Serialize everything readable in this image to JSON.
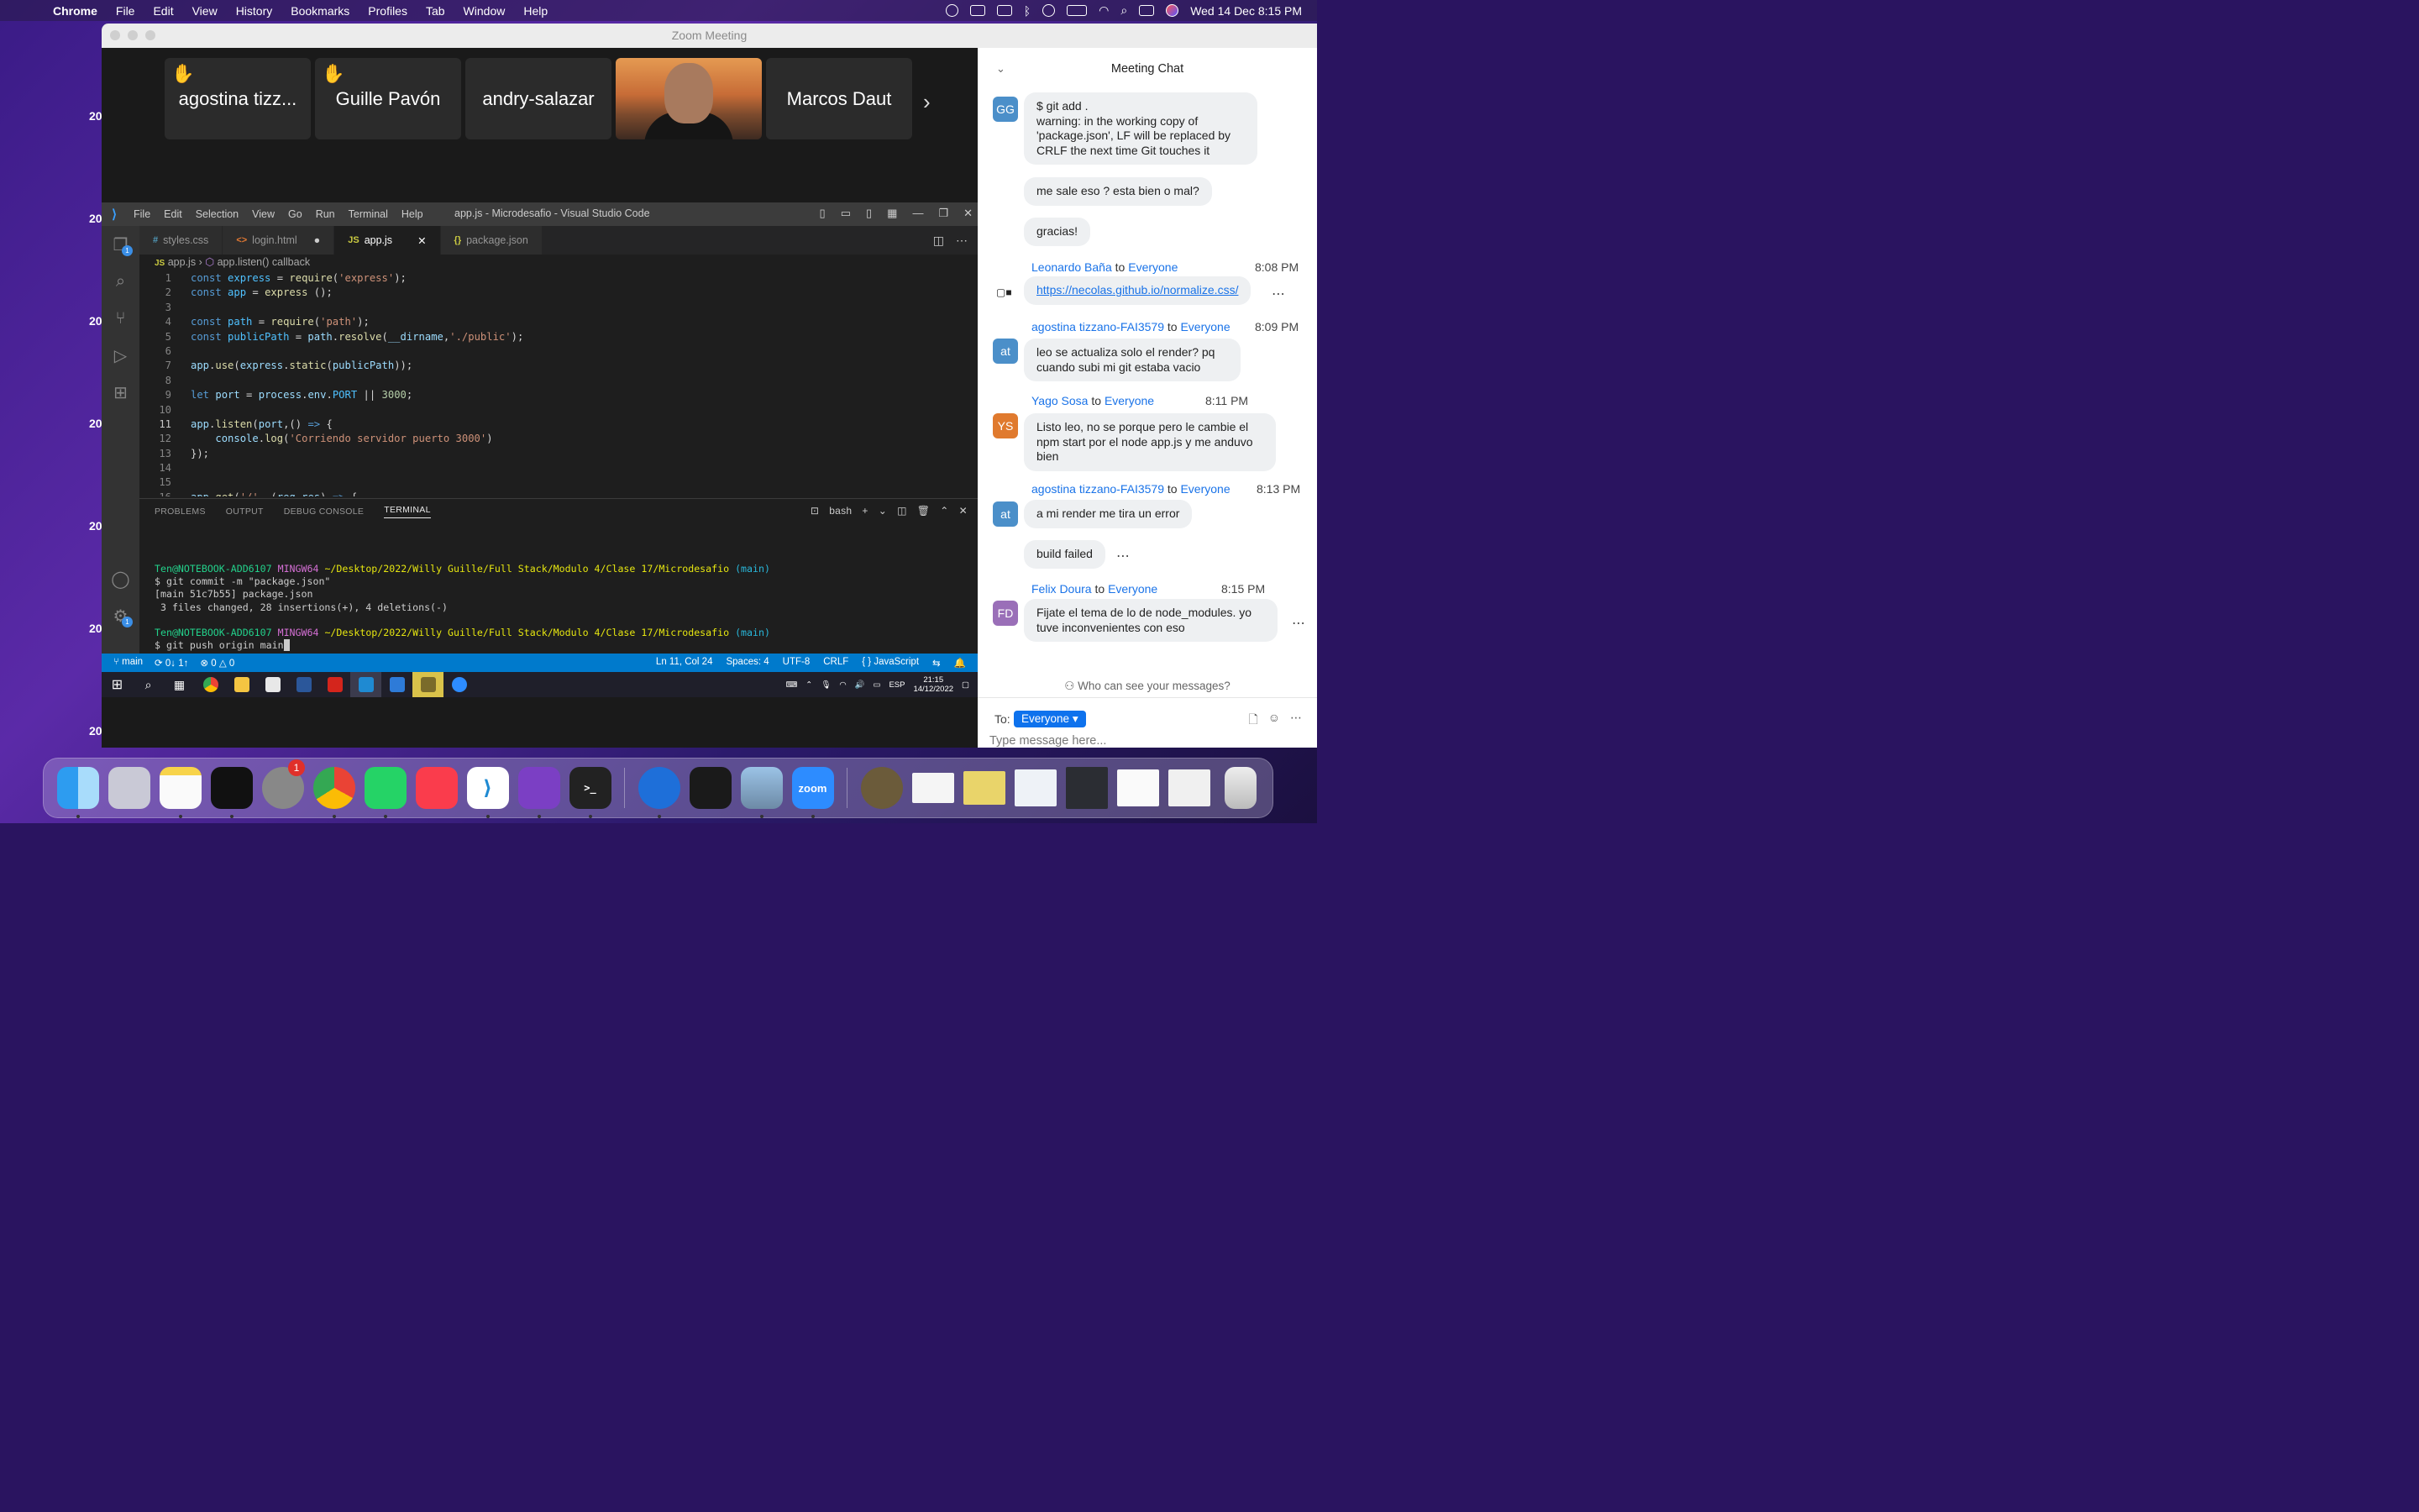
{
  "menubar": {
    "app_name": "Chrome",
    "items": [
      "File",
      "Edit",
      "View",
      "History",
      "Bookmarks",
      "Profiles",
      "Tab",
      "Window",
      "Help"
    ],
    "datetime": "Wed 14 Dec  8:15 PM"
  },
  "zoom": {
    "title": "Zoom Meeting",
    "participants": [
      {
        "name": "agostina tizz...",
        "hand_raised": true
      },
      {
        "name": "Guille Pavón",
        "hand_raised": true
      },
      {
        "name": "andry-salazar",
        "hand_raised": false
      },
      {
        "name": "",
        "hand_raised": false,
        "video": true
      },
      {
        "name": "Marcos Daut",
        "hand_raised": false
      }
    ]
  },
  "vscode": {
    "menu": [
      "File",
      "Edit",
      "Selection",
      "View",
      "Go",
      "Run",
      "Terminal",
      "Help"
    ],
    "title": "app.js - Microdesafio - Visual Studio Code",
    "tabs": [
      {
        "icon": "#",
        "label": "styles.css",
        "active": false
      },
      {
        "icon": "<>",
        "label": "login.html",
        "active": false,
        "modified": true
      },
      {
        "icon": "JS",
        "label": "app.js",
        "active": true
      },
      {
        "icon": "{}",
        "label": "package.json",
        "active": false
      }
    ],
    "breadcrumb": {
      "file": "app.js",
      "symbol": "app.listen() callback"
    },
    "explorer_badge": "1",
    "settings_badge": "1",
    "panel_tabs": [
      "PROBLEMS",
      "OUTPUT",
      "DEBUG CONSOLE",
      "TERMINAL"
    ],
    "panel_shell": "bash",
    "terminal": {
      "user": "Ten@NOTEBOOK-ADD6107",
      "env": "MINGW64",
      "path": "~/Desktop/2022/Willy Guille/Full Stack/Modulo 4/Clase 17/Microdesafio",
      "branch": "(main)",
      "cmd1": "$ git commit -m \"package.json\"",
      "out1": "[main 51c7b55] package.json",
      "out2": " 3 files changed, 28 insertions(+), 4 deletions(-)",
      "cmd2": "$ git push origin main"
    },
    "status": {
      "branch": "main",
      "sync": "0↓ 1↑",
      "problems": "0 △ 0",
      "position": "Ln 11, Col 24",
      "spaces": "Spaces: 4",
      "encoding": "UTF-8",
      "eol": "CRLF",
      "language": "{ } JavaScript"
    }
  },
  "windows_taskbar": {
    "lang": "ESP",
    "time": "21:15",
    "date": "14/12/2022"
  },
  "chat": {
    "title": "Meeting Chat",
    "messages": [
      {
        "avatar": "GG",
        "text": "$ git add .\nwarning: in the working copy of 'package.json', LF will be replaced by CRLF the next time Git touches it"
      },
      {
        "text": "me sale eso ? esta bien o mal?"
      },
      {
        "text": "gracias!"
      },
      {
        "sender": "Leonardo Baña",
        "to": "Everyone",
        "time": "8:08 PM",
        "link": "https://necolas.github.io/normalize.css/"
      },
      {
        "sender": "agostina tizzano-FAI3579",
        "to": "Everyone",
        "time": "8:09 PM",
        "avatar": "at",
        "text": "leo se actualiza solo el render? pq cuando subi mi git estaba vacio"
      },
      {
        "sender": "Yago Sosa",
        "to": "Everyone",
        "time": "8:11 PM",
        "avatar": "YS",
        "text": "Listo leo, no se porque pero le cambie el npm start por el node app.js y me anduvo bien"
      },
      {
        "sender": "agostina tizzano-FAI3579",
        "to": "Everyone",
        "time": "8:13 PM",
        "avatar": "at",
        "text": "a mi render me tira un error"
      },
      {
        "text": "build failed"
      },
      {
        "sender": "Felix Doura",
        "to": "Everyone",
        "time": "8:15 PM",
        "avatar": "FD",
        "text": "Fijate el tema de lo de node_modules. yo tuve inconvenientes con eso"
      }
    ],
    "to_word": "to",
    "who_can_see": "Who can see your messages?",
    "to_label": "To:",
    "recipient": "Everyone",
    "input_placeholder": "Type message here..."
  },
  "desktop_year": "20",
  "dock": {
    "settings_badge": "1",
    "zoom_label": "zoom"
  },
  "colors": {
    "accent": "#0e72ed",
    "vscode_status": "#007acc",
    "avatar_gg": "#4b8fc9",
    "avatar_at": "#4b8fc9",
    "avatar_ys": "#e07a2e",
    "avatar_fd": "#9a6fb8"
  }
}
